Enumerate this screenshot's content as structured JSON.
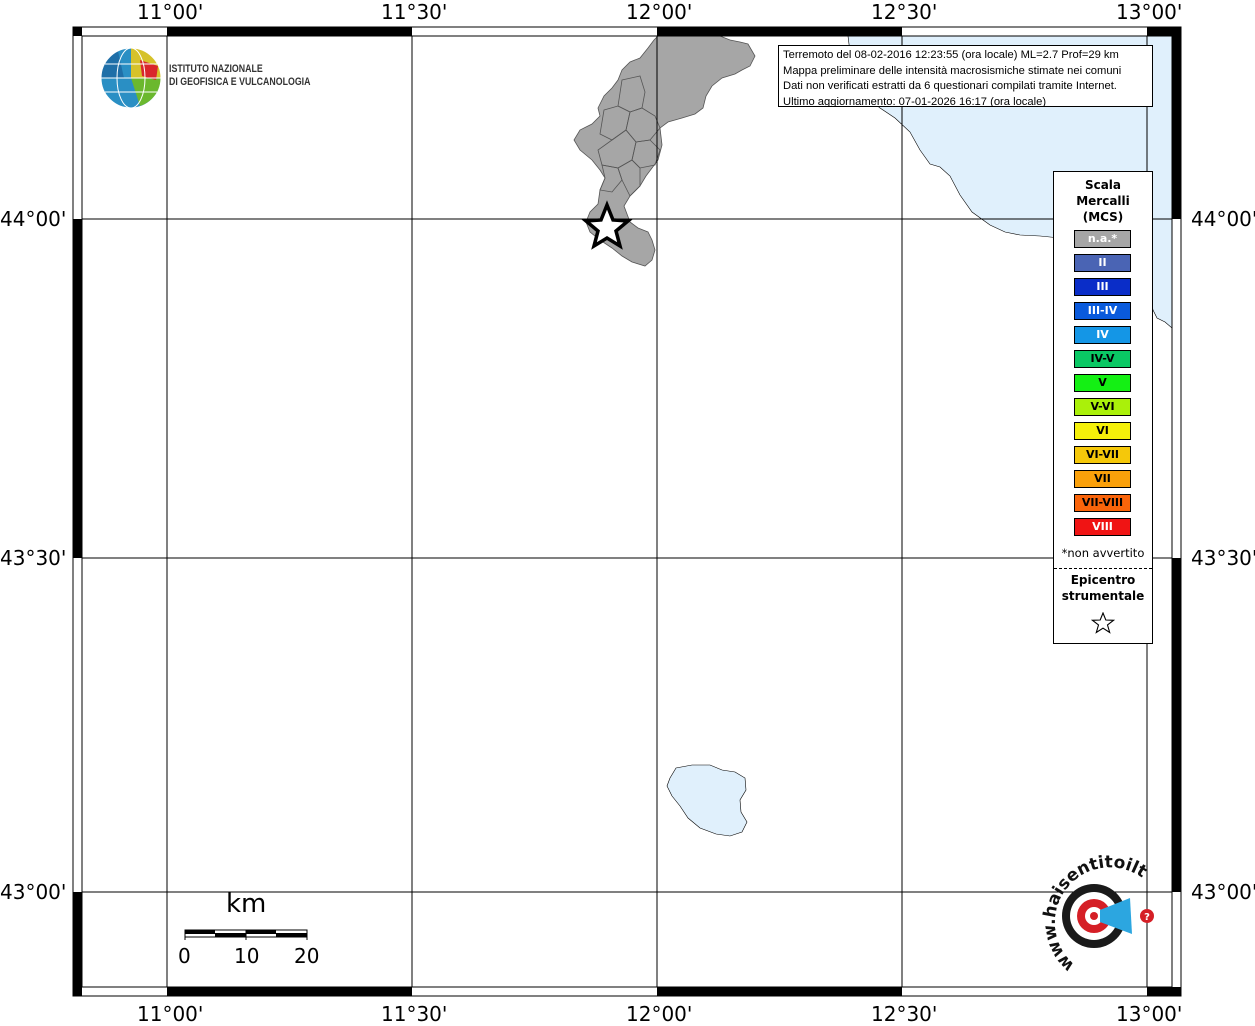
{
  "map": {
    "lon_labels": [
      "11°00'",
      "11°30'",
      "12°00'",
      "12°30'",
      "13°00'"
    ],
    "lat_labels": [
      "44°00'",
      "43°30'",
      "43°00'"
    ],
    "water_color": "#e0f0fc",
    "land_color": "#a6a6a6"
  },
  "info": {
    "line1": "Terremoto del 08-02-2016 12:23:55 (ora locale) ML=2.7 Prof=29 km",
    "line2": "Mappa preliminare delle intensità macrosismiche stimate nei comuni",
    "line3": "Dati non verificati estratti da 6 questionari compilati tramite Internet.",
    "line4": "Ultimo aggiornamento: 07-01-2026 16:17 (ora locale)"
  },
  "institute": {
    "line1": "ISTITUTO NAZIONALE",
    "line2": "DI GEOFISICA E VULCANOLOGIA",
    "logo_icon": "ingv-globe-logo"
  },
  "legend": {
    "title1": "Scala",
    "title2": "Mercalli",
    "title3": "(MCS)",
    "items": [
      {
        "label": "n.a.*",
        "color": "#a6a6a6",
        "text_color": "#ffffff"
      },
      {
        "label": "II",
        "color": "#4a64b4",
        "text_color": "#ffffff"
      },
      {
        "label": "III",
        "color": "#0a2dc8",
        "text_color": "#ffffff"
      },
      {
        "label": "III-IV",
        "color": "#0a5adc",
        "text_color": "#ffffff"
      },
      {
        "label": "IV",
        "color": "#1496e6",
        "text_color": "#ffffff"
      },
      {
        "label": "IV-V",
        "color": "#0ac864",
        "text_color": "#000000"
      },
      {
        "label": "V",
        "color": "#14f014",
        "text_color": "#000000"
      },
      {
        "label": "V-VI",
        "color": "#aaf00a",
        "text_color": "#000000"
      },
      {
        "label": "VI",
        "color": "#f5f00a",
        "text_color": "#000000"
      },
      {
        "label": "VI-VII",
        "color": "#f5c80a",
        "text_color": "#000000"
      },
      {
        "label": "VII",
        "color": "#faa00a",
        "text_color": "#000000"
      },
      {
        "label": "VII-VIII",
        "color": "#fa640a",
        "text_color": "#000000"
      },
      {
        "label": "VIII",
        "color": "#f01414",
        "text_color": "#ffffff"
      }
    ],
    "note": "*non avvertito",
    "epicentre1": "Epicentro",
    "epicentre2": "strumentale",
    "star_icon": "star-outline-icon"
  },
  "scalebar": {
    "unit": "km",
    "ticks": [
      "0",
      "10",
      "20"
    ]
  },
  "brand": {
    "text": "haisentitoilterremoto.it",
    "prefix": "www.",
    "logo_icon": "hai-sentito-logo"
  }
}
